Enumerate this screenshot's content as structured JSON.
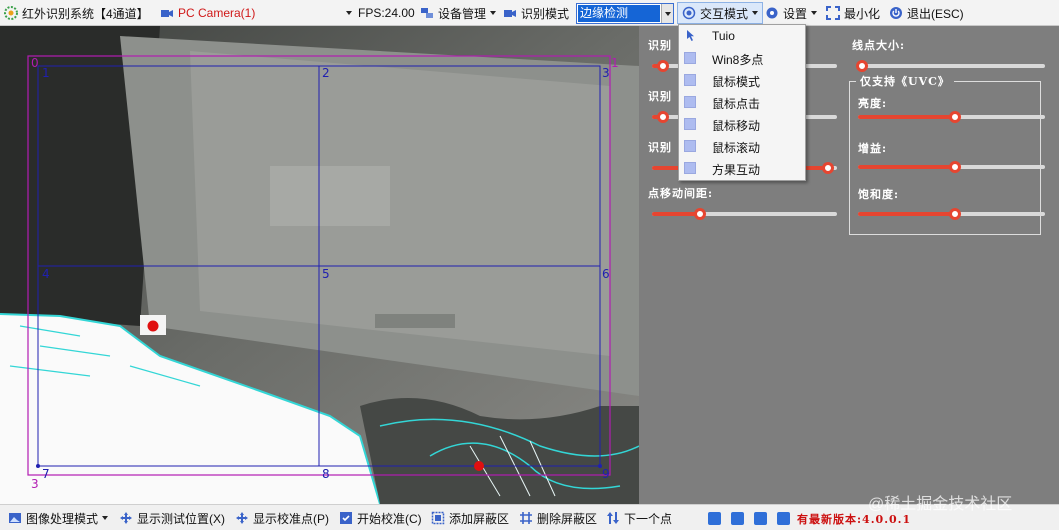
{
  "toolbar": {
    "app_title": "红外识别系统【4通道】",
    "camera": "PC Camera(1)",
    "fps": "FPS:24.00",
    "device_manage": "设备管理",
    "recognition_mode_label": "识别模式",
    "recognition_mode_value": "边缘检测",
    "interaction_mode": "交互模式",
    "settings": "设置",
    "minimize": "最小化",
    "exit": "退出(ESC)"
  },
  "interaction_menu": {
    "items": [
      "Tuio",
      "Win8多点",
      "鼠标模式",
      "鼠标点击",
      "鼠标移动",
      "鼠标滚动",
      "方果互动"
    ]
  },
  "grid": {
    "cell_labels": [
      "1",
      "2",
      "3",
      "4",
      "5",
      "6",
      "7",
      "8",
      "9"
    ],
    "corner_labels": [
      "0",
      "1",
      "3"
    ]
  },
  "panel": {
    "label_recog_1": "识别",
    "label_recog_2": "识别",
    "label_recog_3": "识别",
    "move_interval_label": "点移动间距:",
    "line_point_size_label": "线点大小:",
    "uvc_title": "仅支持《UVC》",
    "brightness_label": "亮度:",
    "gain_label": "增益:",
    "saturation_label": "饱和度:",
    "slider_values": {
      "recog_1": 0.06,
      "recog_2": 0.06,
      "recog_3": 0.95,
      "move_interval": 0.26,
      "line_point_size": 0.02,
      "brightness": 0.52,
      "gain": 0.52,
      "saturation": 0.52
    },
    "accent_color": "#e64530"
  },
  "bottom": {
    "image_mode": "图像处理模式",
    "show_test_pos": "显示测试位置(X)",
    "show_calib_points": "显示校准点(P)",
    "start_calib": "开始校准(C)",
    "add_mask": "添加屏蔽区",
    "remove_mask": "删除屏蔽区",
    "next": "下一个点",
    "version": "有最新版本:4.0.0.1"
  },
  "watermark": "@稀土掘金技术社区"
}
